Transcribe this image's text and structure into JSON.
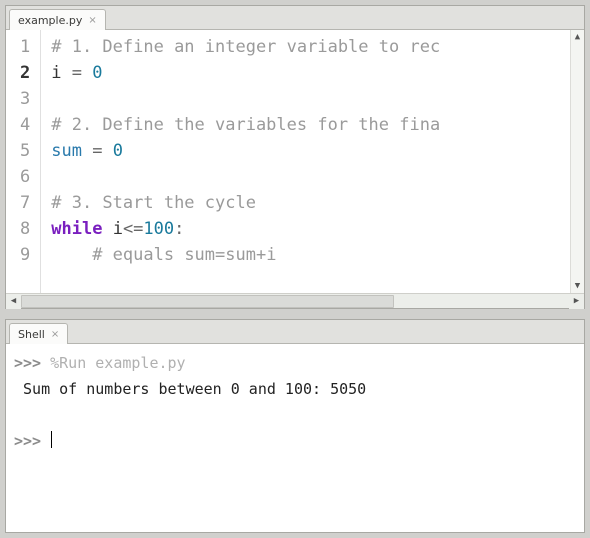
{
  "editor": {
    "tab": {
      "label": "example.py"
    },
    "active_line": 2,
    "lines": [
      {
        "n": 1,
        "tokens": [
          [
            "comment",
            "# 1. Define an integer variable to rec"
          ]
        ]
      },
      {
        "n": 2,
        "tokens": [
          [
            "var",
            "i"
          ],
          [
            "plain",
            " "
          ],
          [
            "op",
            "="
          ],
          [
            "plain",
            " "
          ],
          [
            "num",
            "0"
          ]
        ]
      },
      {
        "n": 3,
        "tokens": []
      },
      {
        "n": 4,
        "tokens": [
          [
            "comment",
            "# 2. Define the variables for the fina"
          ]
        ]
      },
      {
        "n": 5,
        "tokens": [
          [
            "fn",
            "sum"
          ],
          [
            "plain",
            " "
          ],
          [
            "op",
            "="
          ],
          [
            "plain",
            " "
          ],
          [
            "num",
            "0"
          ]
        ]
      },
      {
        "n": 6,
        "tokens": []
      },
      {
        "n": 7,
        "tokens": [
          [
            "comment",
            "# 3. Start the cycle"
          ]
        ]
      },
      {
        "n": 8,
        "tokens": [
          [
            "kw",
            "while"
          ],
          [
            "plain",
            " "
          ],
          [
            "var",
            "i"
          ],
          [
            "op",
            "<="
          ],
          [
            "num",
            "100"
          ],
          [
            "op",
            ":"
          ]
        ]
      },
      {
        "n": 9,
        "tokens": [
          [
            "plain",
            "    "
          ],
          [
            "comment",
            "# equals sum=sum+i"
          ]
        ]
      }
    ]
  },
  "shell": {
    "tab": {
      "label": "Shell"
    },
    "prompt": ">>>",
    "lines": [
      {
        "type": "cmd",
        "text": "%Run example.py"
      },
      {
        "type": "out",
        "text": " Sum of numbers between 0 and 100: 5050"
      },
      {
        "type": "blank"
      },
      {
        "type": "prompt"
      }
    ]
  }
}
